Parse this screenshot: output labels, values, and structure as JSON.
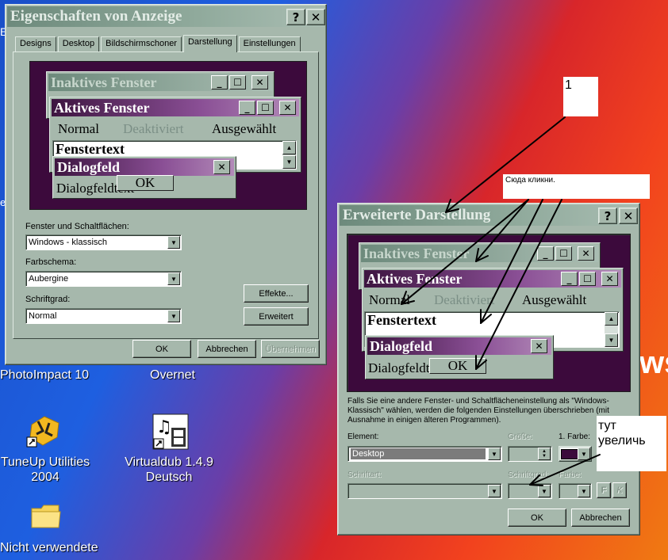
{
  "desktop": {
    "icons": [
      {
        "label": "PhotoImpact 10"
      },
      {
        "label": "Overnet"
      },
      {
        "label": "TuneUp Utilities 2004"
      },
      {
        "label": "Virtualdub 1.4.9 Deutsch"
      },
      {
        "label": "Nicht verwendete"
      }
    ],
    "edge_letter_top": "E",
    "edge_letter_mid": "et",
    "partial_wallpaper_text": "ws"
  },
  "props_window": {
    "title": "Eigenschaften von Anzeige",
    "help_glyph": "?",
    "close_glyph": "✕",
    "tabs": [
      {
        "label": "Designs"
      },
      {
        "label": "Desktop"
      },
      {
        "label": "Bildschirmschoner"
      },
      {
        "label": "Darstellung",
        "selected": true
      },
      {
        "label": "Einstellungen"
      }
    ],
    "preview": {
      "inactive_title": "Inaktives Fenster",
      "active_title": "Aktives Fenster",
      "menu_normal": "Normal",
      "menu_disabled": "Deaktiviert",
      "menu_selected": "Ausgewählt",
      "window_text": "Fenstertext",
      "dialog_title": "Dialogfeld",
      "dialog_text": "Dialogfeldtext",
      "dialog_ok": "OK"
    },
    "label_windows_buttons": "Fenster und Schaltflächen:",
    "value_windows_buttons": "Windows - klassisch",
    "label_color_scheme": "Farbschema:",
    "value_color_scheme": "Aubergine",
    "label_font_size": "Schriftgrad:",
    "value_font_size": "Normal",
    "btn_effects": "Effekte...",
    "btn_advanced": "Erweitert",
    "btn_ok": "OK",
    "btn_cancel": "Abbrechen",
    "btn_apply": "Übernehmen"
  },
  "advanced_window": {
    "title": "Erweiterte Darstellung",
    "help_glyph": "?",
    "close_glyph": "✕",
    "preview": {
      "inactive_title": "Inaktives Fenster",
      "active_title": "Aktives Fenster",
      "menu_normal": "Normal",
      "menu_disabled": "Deaktiviert",
      "menu_selected": "Ausgewählt",
      "window_text": "Fenstertext",
      "dialog_title": "Dialogfeld",
      "dialog_text": "Dialogfeldtext",
      "dialog_ok": "OK"
    },
    "info_text": "Falls Sie eine andere Fenster- und Schaltflächeneinstellung als \"Windows-Klassisch\" wählen, werden die folgenden Einstellungen überschrieben (mit Ausnahme in einigen älteren Programmen).",
    "label_element": "Element:",
    "value_element": "Desktop",
    "label_size": "Größe:",
    "label_color1": "1. Farbe:",
    "color1": "#3c0a3c",
    "label_font": "Schriftart:",
    "label_font_size": "Schriftgrad:",
    "label_color": "Farbe:",
    "bold_glyph": "F",
    "italic_glyph": "K",
    "btn_ok": "OK",
    "btn_cancel": "Abbrechen"
  },
  "annotations": {
    "note1": "1",
    "note_click": "Сюда кликни.",
    "note_enlarge": "тут увеличь"
  },
  "colors": {
    "face": "#a6b8ac",
    "preview_bg": "#3c0a3c",
    "active_title": "#8a4f95",
    "inactive_title": "#90aa9c"
  }
}
